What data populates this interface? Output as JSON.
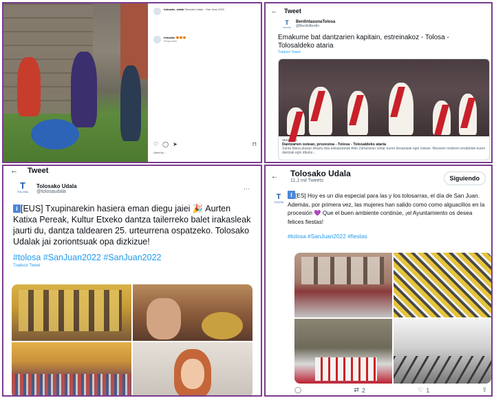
{
  "panel1": {
    "post_text": "Tolosako Udala · San Joan 2022",
    "comment_user": "tolosako",
    "comment_text": "",
    "likes_text": "Liked by ...",
    "reply_label": "Responder"
  },
  "panel2": {
    "header_title": "Tweet",
    "account_name": "BerdintasunaTolosa",
    "account_handle": "@BerdinBerdin",
    "logo_text": "T",
    "logo_word": "TOLOSA",
    "tweet_text": "Emakume bat dantzarien kapitain, estreinakoz - Tolosa - Tolosaldeko ataria",
    "translate_label": "Traducir Tweet",
    "card_domain": "ataria.eus",
    "card_title": "Dantzarien ostean, prozesioa - Tolosa - Tolosaldeko ataria",
    "card_desc": "Santa Maria plazan elkartu dira eskopetariak Aldo Zaharraren zohar euren desanaiak egin ostean. Mozaren ondoren erraldoiek euren dantzak egin dituzte..."
  },
  "panel3": {
    "header_title": "Tweet",
    "account_name": "Tolosako Udala",
    "account_handle": "@tolosaudala",
    "logo_text": "T",
    "logo_word": "TOLOSA",
    "more_label": "···",
    "badge": "i",
    "tweet_text": "[EUS] Txupinarekin hasiera eman diegu jaiei 🎉 Aurten Katixa Pereak, Kultur Etxeko dantza tailerreko balet irakasleak jaurti du, dantza taldearen 25. urteurrena ospatzeko. Tolosako Udalak jai zoriontsuak opa dizkizue!",
    "hashtags": "#tolosa #SanJuan2022 #SanJuan2022",
    "translate_label": "Traducir Tweet"
  },
  "panel4": {
    "back_label": "←",
    "account_name": "Tolosako Udala",
    "tweet_count": "11,1 mil Tweets",
    "follow_label": "Siguiendo",
    "logo_text": "T",
    "logo_word": "TOLOSA",
    "badge": "i",
    "tweet_text": "[ES] Hoy es un día especial para las y los tolosarras, el día de San Juan. Además, por primera vez, las mujeres han salido como como alguacillos en la procesión 💜 Que el buen ambiente continúe, ¡el Ayuntamiento os desea felices fiestas!",
    "hashtags": "#tolosa #SanJuan2022 #fiestas",
    "retweet_count": "2",
    "like_count": "1"
  }
}
